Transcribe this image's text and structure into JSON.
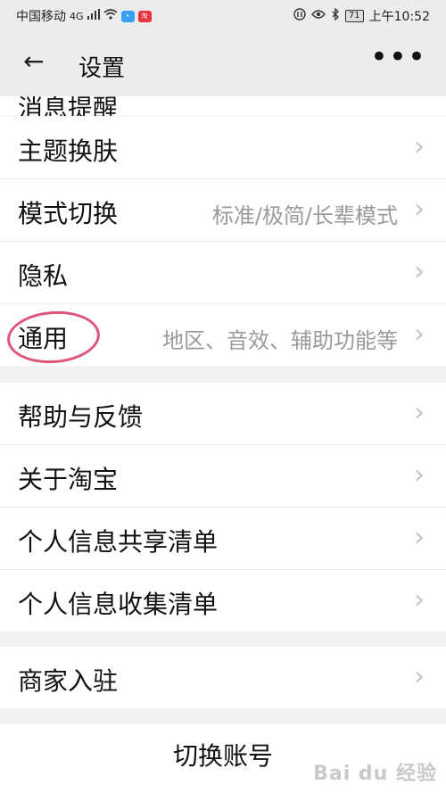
{
  "status_bar": {
    "carrier": "中国移动",
    "network": "4G",
    "battery": "71",
    "time": "上午10:52"
  },
  "header": {
    "title": "设置"
  },
  "partial_row": {
    "label": "消息提醒"
  },
  "group1": {
    "items": [
      {
        "label": "主题换肤",
        "value": ""
      },
      {
        "label": "模式切换",
        "value": "标准/极简/长辈模式"
      },
      {
        "label": "隐私",
        "value": ""
      },
      {
        "label": "通用",
        "value": "地区、音效、辅助功能等"
      }
    ]
  },
  "group2": {
    "items": [
      {
        "label": "帮助与反馈"
      },
      {
        "label": "关于淘宝"
      },
      {
        "label": "个人信息共享清单"
      },
      {
        "label": "个人信息收集清单"
      }
    ]
  },
  "group3": {
    "items": [
      {
        "label": "商家入驻"
      }
    ]
  },
  "switch_account": {
    "label": "切换账号"
  },
  "watermark": {
    "text": "Bai du 经验"
  },
  "colors": {
    "highlight_circle": "#e0567a",
    "background": "#f2f2f2"
  }
}
